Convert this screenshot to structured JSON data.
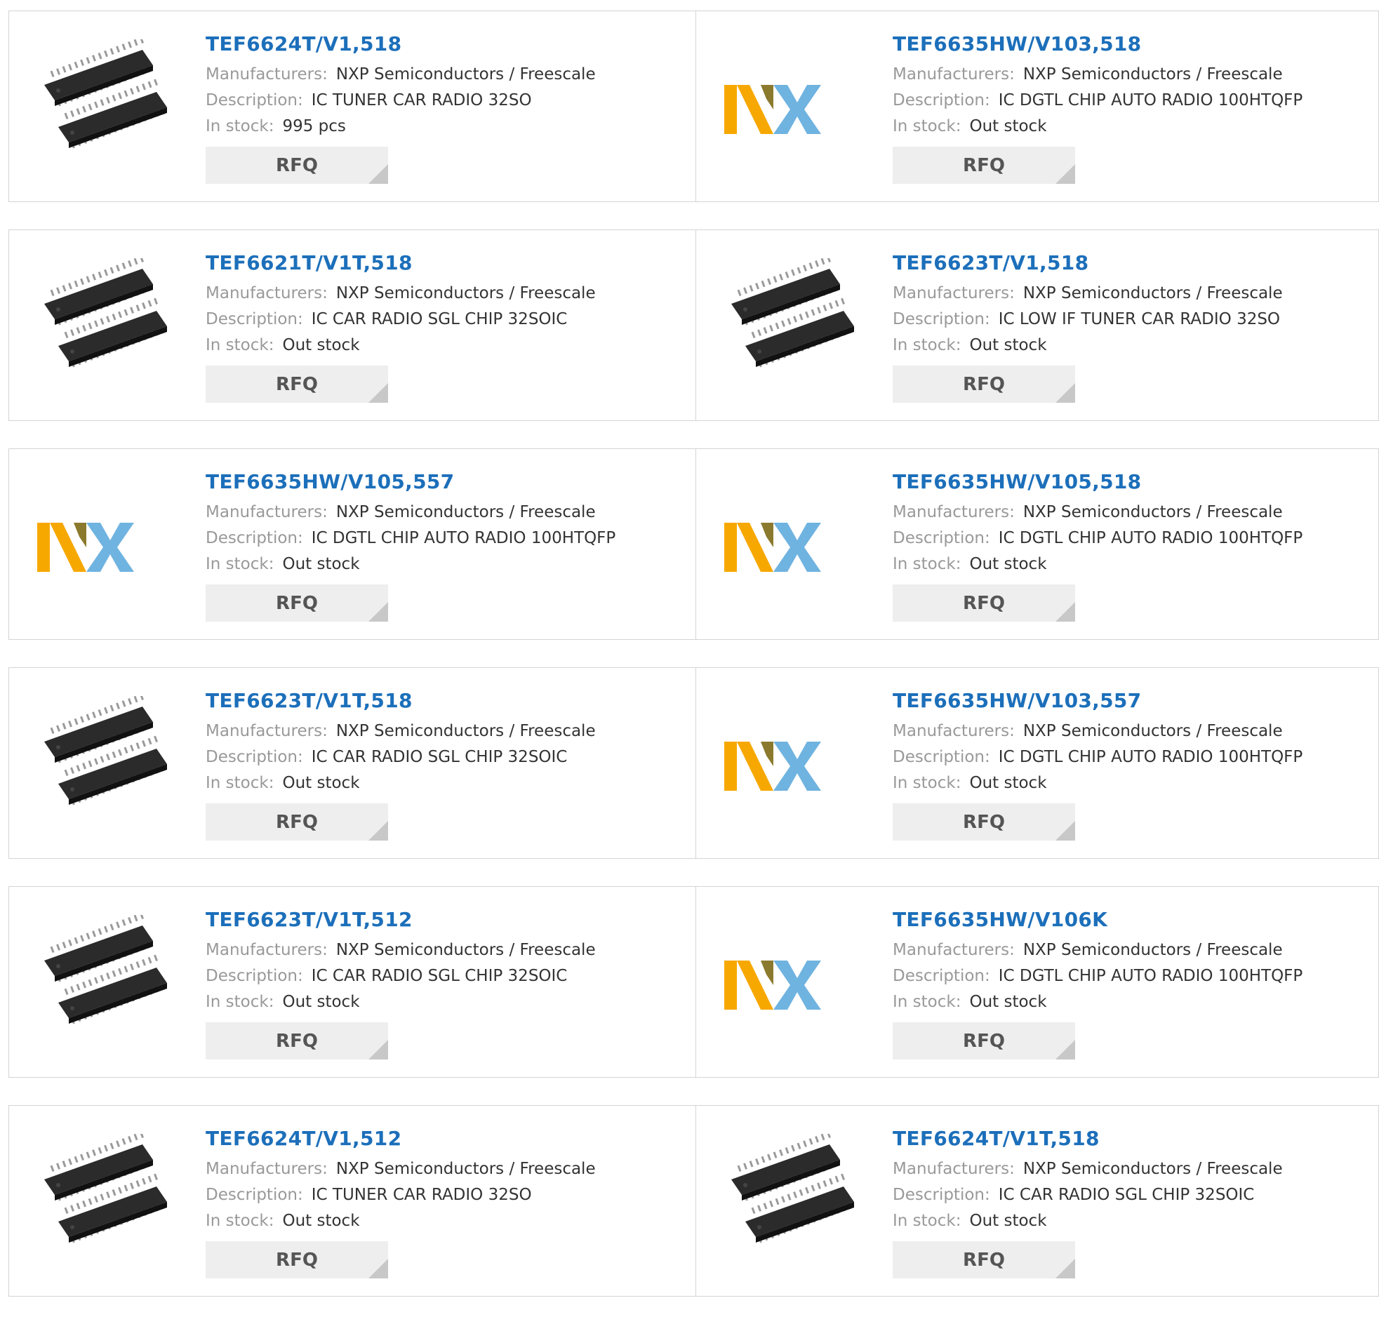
{
  "labels": {
    "manufacturers": "Manufacturers:",
    "description": "Description:",
    "in_stock": "In stock:",
    "rfq": "RFQ"
  },
  "colors": {
    "title": "#1c6fba",
    "nxp_orange": "#f7a800",
    "nxp_brown": "#8b7a2d",
    "nxp_blue": "#6fb3e0",
    "nxp_green": "#c4d600"
  },
  "logo_text": "NXP",
  "products": [
    {
      "part": "TEF6624T/V1,518",
      "manufacturer": "NXP Semiconductors / Freescale",
      "description": "IC TUNER CAR RADIO 32SO",
      "stock": "995 pcs",
      "image": "chip"
    },
    {
      "part": "TEF6635HW/V103,518",
      "manufacturer": "NXP Semiconductors / Freescale",
      "description": "IC DGTL CHIP AUTO RADIO 100HTQFP",
      "stock": "Out stock",
      "image": "nxp-logo"
    },
    {
      "part": "TEF6621T/V1T,518",
      "manufacturer": "NXP Semiconductors / Freescale",
      "description": "IC CAR RADIO SGL CHIP 32SOIC",
      "stock": "Out stock",
      "image": "chip"
    },
    {
      "part": "TEF6623T/V1,518",
      "manufacturer": "NXP Semiconductors / Freescale",
      "description": "IC LOW IF TUNER CAR RADIO 32SO",
      "stock": "Out stock",
      "image": "chip"
    },
    {
      "part": "TEF6635HW/V105,557",
      "manufacturer": "NXP Semiconductors / Freescale",
      "description": "IC DGTL CHIP AUTO RADIO 100HTQFP",
      "stock": "Out stock",
      "image": "nxp-logo"
    },
    {
      "part": "TEF6635HW/V105,518",
      "manufacturer": "NXP Semiconductors / Freescale",
      "description": "IC DGTL CHIP AUTO RADIO 100HTQFP",
      "stock": "Out stock",
      "image": "nxp-logo"
    },
    {
      "part": "TEF6623T/V1T,518",
      "manufacturer": "NXP Semiconductors / Freescale",
      "description": "IC CAR RADIO SGL CHIP 32SOIC",
      "stock": "Out stock",
      "image": "chip"
    },
    {
      "part": "TEF6635HW/V103,557",
      "manufacturer": "NXP Semiconductors / Freescale",
      "description": "IC DGTL CHIP AUTO RADIO 100HTQFP",
      "stock": "Out stock",
      "image": "nxp-logo"
    },
    {
      "part": "TEF6623T/V1T,512",
      "manufacturer": "NXP Semiconductors / Freescale",
      "description": "IC CAR RADIO SGL CHIP 32SOIC",
      "stock": "Out stock",
      "image": "chip"
    },
    {
      "part": "TEF6635HW/V106K",
      "manufacturer": "NXP Semiconductors / Freescale",
      "description": "IC DGTL CHIP AUTO RADIO 100HTQFP",
      "stock": "Out stock",
      "image": "nxp-logo"
    },
    {
      "part": "TEF6624T/V1,512",
      "manufacturer": "NXP Semiconductors / Freescale",
      "description": "IC TUNER CAR RADIO 32SO",
      "stock": "Out stock",
      "image": "chip"
    },
    {
      "part": "TEF6624T/V1T,518",
      "manufacturer": "NXP Semiconductors / Freescale",
      "description": "IC CAR RADIO SGL CHIP 32SOIC",
      "stock": "Out stock",
      "image": "chip"
    }
  ]
}
